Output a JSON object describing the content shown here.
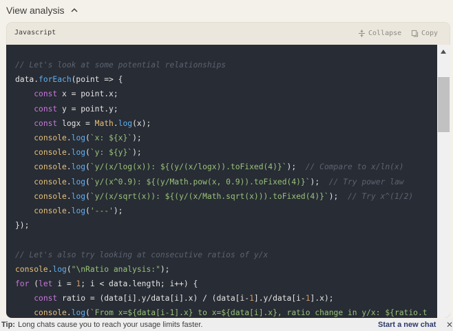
{
  "analysis_toggle": {
    "label": "View analysis",
    "expanded": true,
    "icon": "chevron-up-icon"
  },
  "code_block": {
    "language": "Javascript",
    "collapse_label": "Collapse",
    "copy_label": "Copy",
    "lines": [
      "// Let's look at some potential relationships",
      "data.forEach(point => {",
      "    const x = point.x;",
      "    const y = point.y;",
      "    const logx = Math.log(x);",
      "    console.log(`x: ${x}`);",
      "    console.log(`y: ${y}`);",
      "    console.log(`y/(x/log(x)): ${(y/(x/logx)).toFixed(4)}`);  // Compare to x/ln(x)",
      "    console.log(`y/(x^0.9): ${(y/Math.pow(x, 0.9)).toFixed(4)}`);  // Try power law",
      "    console.log(`y/(x/sqrt(x)): ${(y/(x/Math.sqrt(x))).toFixed(4)}`);  // Try x^(1/2)",
      "    console.log('---');",
      "});",
      "",
      "// Let's also try looking at consecutive ratios of y/x",
      "console.log(\"\\nRatio analysis:\");",
      "for (let i = 1; i < data.length; i++) {",
      "    const ratio = (data[i].y/data[i].x) / (data[i-1].y/data[i-1].x);",
      "    console.log(`From x=${data[i-1].x} to x=${data[i].x}, ratio change in y/x: ${ratio.t"
    ]
  },
  "tip_bar": {
    "label": "Tip:",
    "text": "Long chats cause you to reach your usage limits faster.",
    "action": "Start a new chat",
    "close_icon": "close-icon"
  },
  "colors": {
    "background": "#f4f1ea",
    "code_background": "#282c34",
    "link": "#2e3a6b"
  }
}
